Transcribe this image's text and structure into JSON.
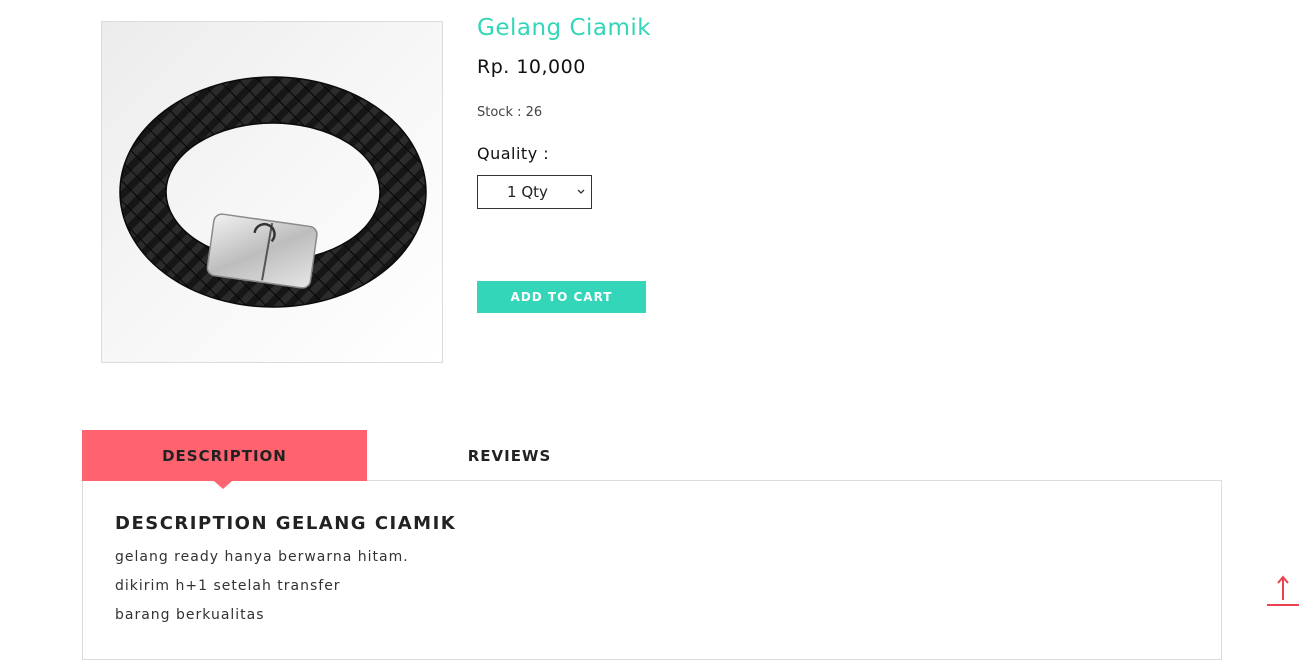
{
  "product": {
    "title": "Gelang Ciamik",
    "price": "Rp. 10,000",
    "stock": "Stock : 26",
    "image_icon": "leather-bracelet-image"
  },
  "purchase": {
    "quantity_label": "Quality :",
    "quantity_selected": "1 Qty",
    "add_to_cart_label": "ADD TO CART"
  },
  "tabs": [
    {
      "label": "DESCRIPTION",
      "active": true
    },
    {
      "label": "REVIEWS",
      "active": false
    }
  ],
  "description": {
    "heading": "DESCRIPTION GELANG CIAMIK",
    "lines": [
      "gelang ready hanya berwarna hitam.",
      "dikirim h+1 setelah transfer",
      "barang berkualitas"
    ]
  },
  "colors": {
    "accent": "#33d6b8",
    "active_tab": "#ff6370",
    "scroll_top": "#e8434e"
  },
  "icons": {
    "select_chevron": "chevron-down-icon",
    "scroll_top": "arrow-up-icon"
  }
}
